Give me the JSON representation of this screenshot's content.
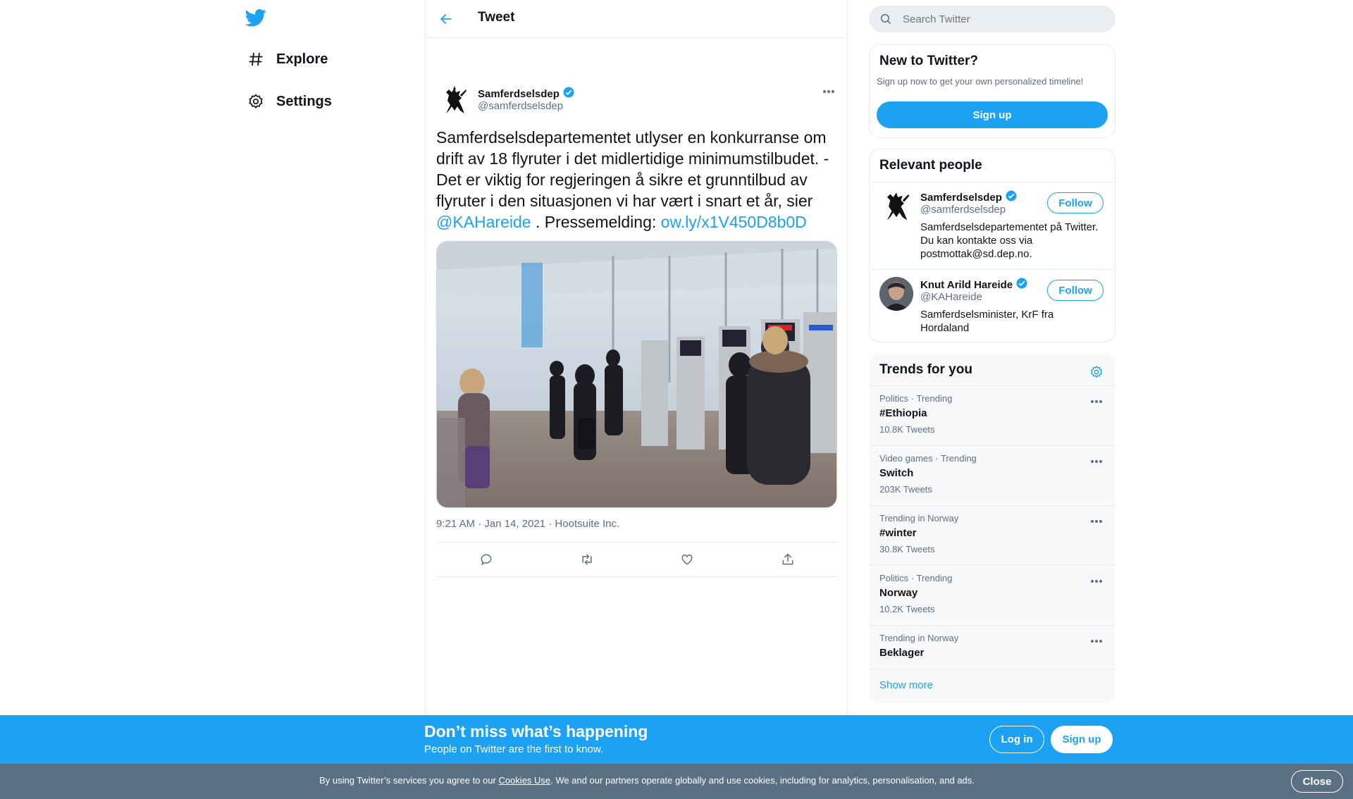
{
  "nav": {
    "items": [
      {
        "label": "Explore",
        "icon": "hashtag-icon"
      },
      {
        "label": "Settings",
        "icon": "gear-icon"
      }
    ]
  },
  "header": {
    "title": "Tweet"
  },
  "tweet": {
    "author_name": "Samferdselsdep",
    "author_handle": "@samferdselsdep",
    "text_main": "Samferdselsdepartementet utlyser en konkurranse om drift av 18 flyruter i det midlertidige minimumstilbudet.  - Det er viktig for regjeringen å sikre et grunntilbud av flyruter i den situasjonen vi har vært i snart et år, sier",
    "mention": "@KAHareide",
    "text_mid": " . Pressemelding: ",
    "link": "ow.ly/x1V450D8b0D",
    "meta": "9:21 AM · Jan 14, 2021 · Hootsuite Inc."
  },
  "search": {
    "placeholder": "Search Twitter"
  },
  "new_to_twitter": {
    "title": "New to Twitter?",
    "subtitle": "Sign up now to get your own personalized timeline!",
    "button": "Sign up"
  },
  "relevant_people": {
    "title": "Relevant people",
    "people": [
      {
        "name": "Samferdselsdep",
        "handle": "@samferdselsdep",
        "bio": "Samferdselsdepartementet på Twitter. Du kan kontakte oss via postmottak@sd.dep.no.",
        "follow": "Follow"
      },
      {
        "name": "Knut Arild Hareide",
        "handle": "@KAHareide",
        "bio": "Samferdselsminister, KrF fra Hordaland",
        "follow": "Follow"
      }
    ]
  },
  "trends": {
    "title": "Trends for you",
    "items": [
      {
        "context": "Politics · Trending",
        "name": "#Ethiopia",
        "count": "10.8K Tweets"
      },
      {
        "context": "Video games · Trending",
        "name": "Switch",
        "count": "203K Tweets"
      },
      {
        "context": "Trending in Norway",
        "name": "#winter",
        "count": "30.8K Tweets"
      },
      {
        "context": "Politics · Trending",
        "name": "Norway",
        "count": "10.2K Tweets"
      },
      {
        "context": "Trending in Norway",
        "name": "Beklager",
        "count": ""
      }
    ],
    "show_more": "Show more"
  },
  "bottom_bar": {
    "title": "Don’t miss what’s happening",
    "subtitle": "People on Twitter are the first to know.",
    "login": "Log in",
    "signup": "Sign up"
  },
  "cookie": {
    "before": "By using Twitter’s services you agree to our ",
    "link": "Cookies Use",
    "after": ". We and our partners operate globally and use cookies, including for analytics, personalisation, and ads.",
    "close": "Close"
  },
  "colors": {
    "brand": "#1da1f2",
    "text": "#0f1419",
    "secondary": "#5b7083",
    "cookie_bg": "#5b7083"
  }
}
